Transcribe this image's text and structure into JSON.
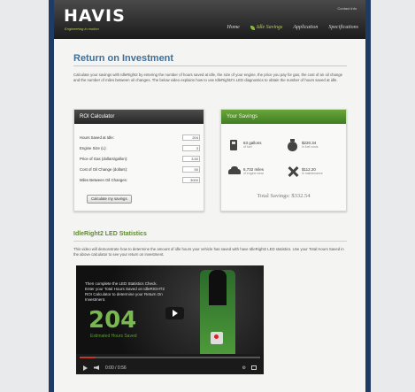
{
  "header": {
    "logo": "HAVIS",
    "tagline": "Engineering in motion",
    "contact": "Contact Info",
    "nav": [
      "Home",
      "Idle Savings",
      "Application",
      "Specifications"
    ]
  },
  "main": {
    "title": "Return on Investment",
    "intro": "Calculate your savings with IdleRight2 by entering the number of hours saved at idle, the size of your engine, the price you pay for gas, the cost of an oil change and the number of miles between oil changes. The below video explains how to use IdleRight2's LED diagnostics to obtain the number of hours saved at idle."
  },
  "calculator": {
    "title": "ROI Calculator",
    "fields": [
      {
        "label": "Hours Saved at Idle:",
        "value": "204"
      },
      {
        "label": "Engine Size (L):",
        "value": "3"
      },
      {
        "label": "Price of Gas (dollars/gallon):",
        "value": "3.50"
      },
      {
        "label": "Cost of Oil Change (dollars):",
        "value": "50"
      },
      {
        "label": "Miles Between Oil Changes:",
        "value": "3000"
      }
    ],
    "button": "Calculate my savings"
  },
  "savings": {
    "title": "Your Savings",
    "fuel_amount": "63 gallons",
    "fuel_sub": "of fuel",
    "fuel_dollars": "$220.34",
    "fuel_dollars_sub": "in fuel costs",
    "miles_amount": "6,732 miles",
    "miles_sub": "of engine wear",
    "maint_dollars": "$112.20",
    "maint_sub": "in maintenance",
    "total_label": "Total Savings:",
    "total_value": "$332.54"
  },
  "led": {
    "title": "IdleRight2 LED Statistics",
    "desc": "This video will demonstrate how to determine the amount of idle hours your vehicle has saved with have IdleRight2 LED statistics. Use your Total Hours Saved in the above calculator to see your return on investment."
  },
  "video": {
    "caption": "Then complete the LED Statistics Check. Enter your Total Hours Saved on IdleRIGHT2 ROI Calculator to determine your Return On Investment.",
    "number": "204",
    "sub": "Estimated Hours Saved",
    "time": "0:00 / 0:56",
    "progress_fraction": 0.09
  }
}
